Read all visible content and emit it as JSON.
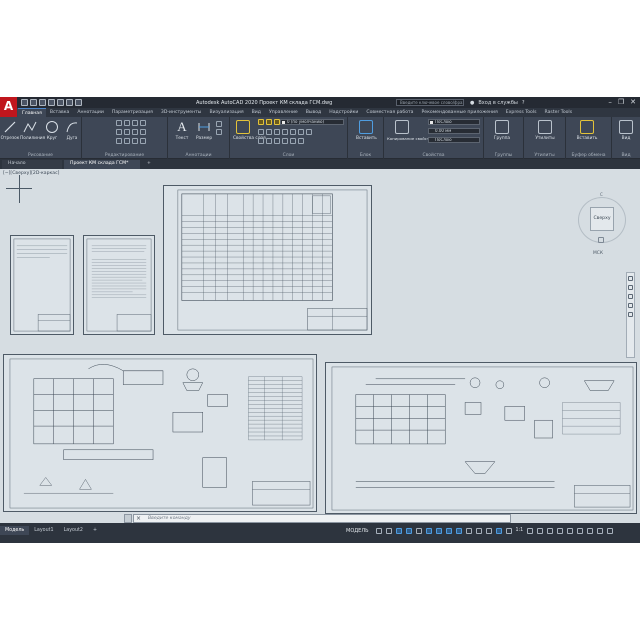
{
  "titlebar": {
    "logo": "A",
    "window_title": "Autodesk AutoCAD 2020   Проект КМ склада ГСМ.dwg",
    "search_placeholder": "Введите ключевое слово/фразу",
    "sign_in": "Вход в службы",
    "help": "?"
  },
  "ribbon_tabs": [
    "Главная",
    "Вставка",
    "Аннотации",
    "Параметризация",
    "3D-инструменты",
    "Визуализация",
    "Вид",
    "Управление",
    "Вывод",
    "Надстройки",
    "Совместная работа",
    "Рекомендованные приложения",
    "Express Tools",
    "Raster Tools"
  ],
  "ribbon": {
    "draw_tools": [
      "Отрезок",
      "Полилиния",
      "Круг",
      "Дуга"
    ],
    "text_tool": "Текст",
    "dim_tool": "Размер",
    "layer_props_tool": "Свойства слоя",
    "insert_tool": "Вставить",
    "match_props_tool": "Копирование свойств",
    "group_tool": "Группа",
    "utilities_tool": "Утилиты",
    "paste_tool": "Вставить",
    "view_tool": "Вид",
    "layer_current": "0 (по умолчанию)",
    "color_value": "ПоСлою",
    "linetype_value": "ПоСлою",
    "lineweight_value": "0.00 мм",
    "groups": [
      "Рисование",
      "Редактирование",
      "Аннотации",
      "Слои",
      "Блок",
      "Свойства",
      "Группы",
      "Утилиты",
      "Буфер обмена",
      "Вид"
    ]
  },
  "file_tabs": {
    "start": "Начало",
    "document": "Проект КМ склада ГСМ*",
    "add": "+"
  },
  "canvas": {
    "viewport_label": "[−][Сверху][2D-каркас]",
    "viewcube_top": "Сверху",
    "viewcube_north": "С",
    "wcs_label": "МСК"
  },
  "command_line": {
    "prompt": "Введите команду"
  },
  "statusbar": {
    "layout_tabs": [
      "Модель",
      "Layout1",
      "Layout2"
    ],
    "add_layout": "+",
    "model_label": "МОДЕЛЬ",
    "scale": "1:1"
  },
  "colors": {
    "background_dark": "#3b4453",
    "ribbon_panel": "#3e4756",
    "canvas": "#d6dde2",
    "logo_red": "#c0161d",
    "accent_blue": "#4f9de0"
  }
}
